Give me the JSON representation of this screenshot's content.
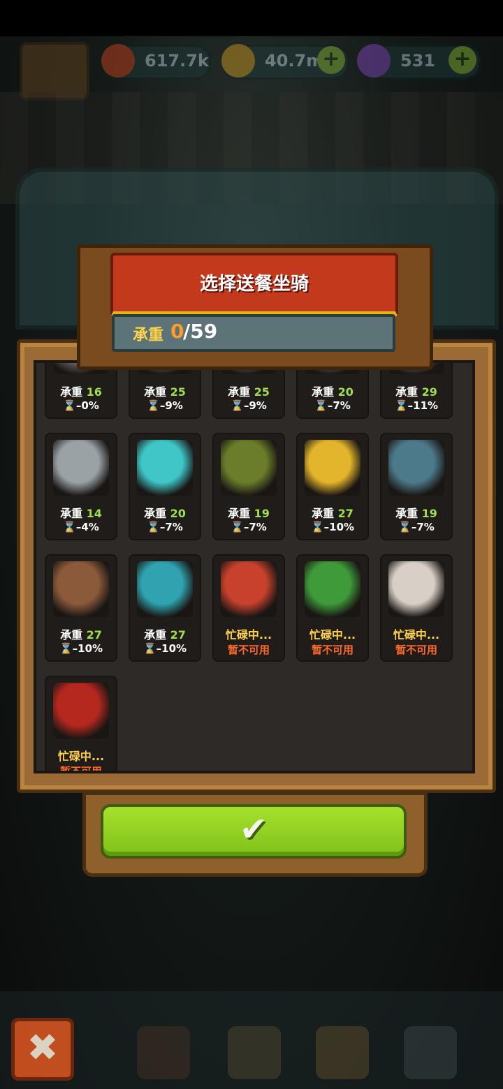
{
  "hud": {
    "eyes": "617.7k",
    "coins": "40.7m",
    "potions": "531"
  },
  "dialog": {
    "title": "选择送餐坐骑",
    "capacity_label": "承重",
    "capacity_current": "0",
    "capacity_max": "/59"
  },
  "rows": [
    [
      {
        "l1_label": "承重",
        "l1_value": "16",
        "l2": "⌛–0%",
        "busy": false,
        "color": "#6b6b6b"
      },
      {
        "l1_label": "承重",
        "l1_value": "25",
        "l2": "⌛–9%",
        "busy": false,
        "color": "#6b6b6b"
      },
      {
        "l1_label": "承重",
        "l1_value": "25",
        "l2": "⌛–9%",
        "busy": false,
        "color": "#6b6b6b"
      },
      {
        "l1_label": "承重",
        "l1_value": "20",
        "l2": "⌛–7%",
        "busy": false,
        "color": "#6b6b6b"
      },
      {
        "l1_label": "承重",
        "l1_value": "29",
        "l2": "⌛–11%",
        "busy": false,
        "color": "#6b6b6b"
      }
    ],
    [
      {
        "l1_label": "承重",
        "l1_value": "14",
        "l2": "⌛–4%",
        "busy": false,
        "color": "#9aa2a6",
        "icon": "robot-cart-mount-icon"
      },
      {
        "l1_label": "承重",
        "l1_value": "20",
        "l2": "⌛–7%",
        "busy": false,
        "color": "#3fc6c6",
        "icon": "cyan-blob-mount-icon"
      },
      {
        "l1_label": "承重",
        "l1_value": "19",
        "l2": "⌛–7%",
        "busy": false,
        "color": "#6b7d2a",
        "icon": "tree-mount-icon"
      },
      {
        "l1_label": "承重",
        "l1_value": "27",
        "l2": "⌛–10%",
        "busy": false,
        "color": "#e3b52a",
        "icon": "yellow-beast-mount-icon"
      },
      {
        "l1_label": "承重",
        "l1_value": "19",
        "l2": "⌛–7%",
        "busy": false,
        "color": "#4c7a8a",
        "icon": "bubble-mount-icon"
      }
    ],
    [
      {
        "l1_label": "承重",
        "l1_value": "27",
        "l2": "⌛–10%",
        "busy": false,
        "color": "#8a5a3a",
        "icon": "mask-mount-icon"
      },
      {
        "l1_label": "承重",
        "l1_value": "27",
        "l2": "⌛–10%",
        "busy": false,
        "color": "#2fa3b0",
        "icon": "fish-mount-icon"
      },
      {
        "l1_label": "忙碌中...",
        "l1_value": "",
        "l2": "暂不可用",
        "busy": true,
        "color": "#c7412c",
        "icon": "lion-dance-mount-icon"
      },
      {
        "l1_label": "忙碌中...",
        "l1_value": "",
        "l2": "暂不可用",
        "busy": true,
        "color": "#3f9a3a",
        "icon": "dragon-mount-icon"
      },
      {
        "l1_label": "忙碌中...",
        "l1_value": "",
        "l2": "暂不可用",
        "busy": true,
        "color": "#d8cfc6",
        "icon": "rabbit-mount-icon"
      }
    ],
    [
      {
        "l1_label": "忙碌中...",
        "l1_value": "",
        "l2": "暂不可用",
        "busy": true,
        "color": "#b5281e",
        "icon": "demon-mount-icon"
      }
    ]
  ],
  "confirm_icon": "✔",
  "close_icon": "✖"
}
